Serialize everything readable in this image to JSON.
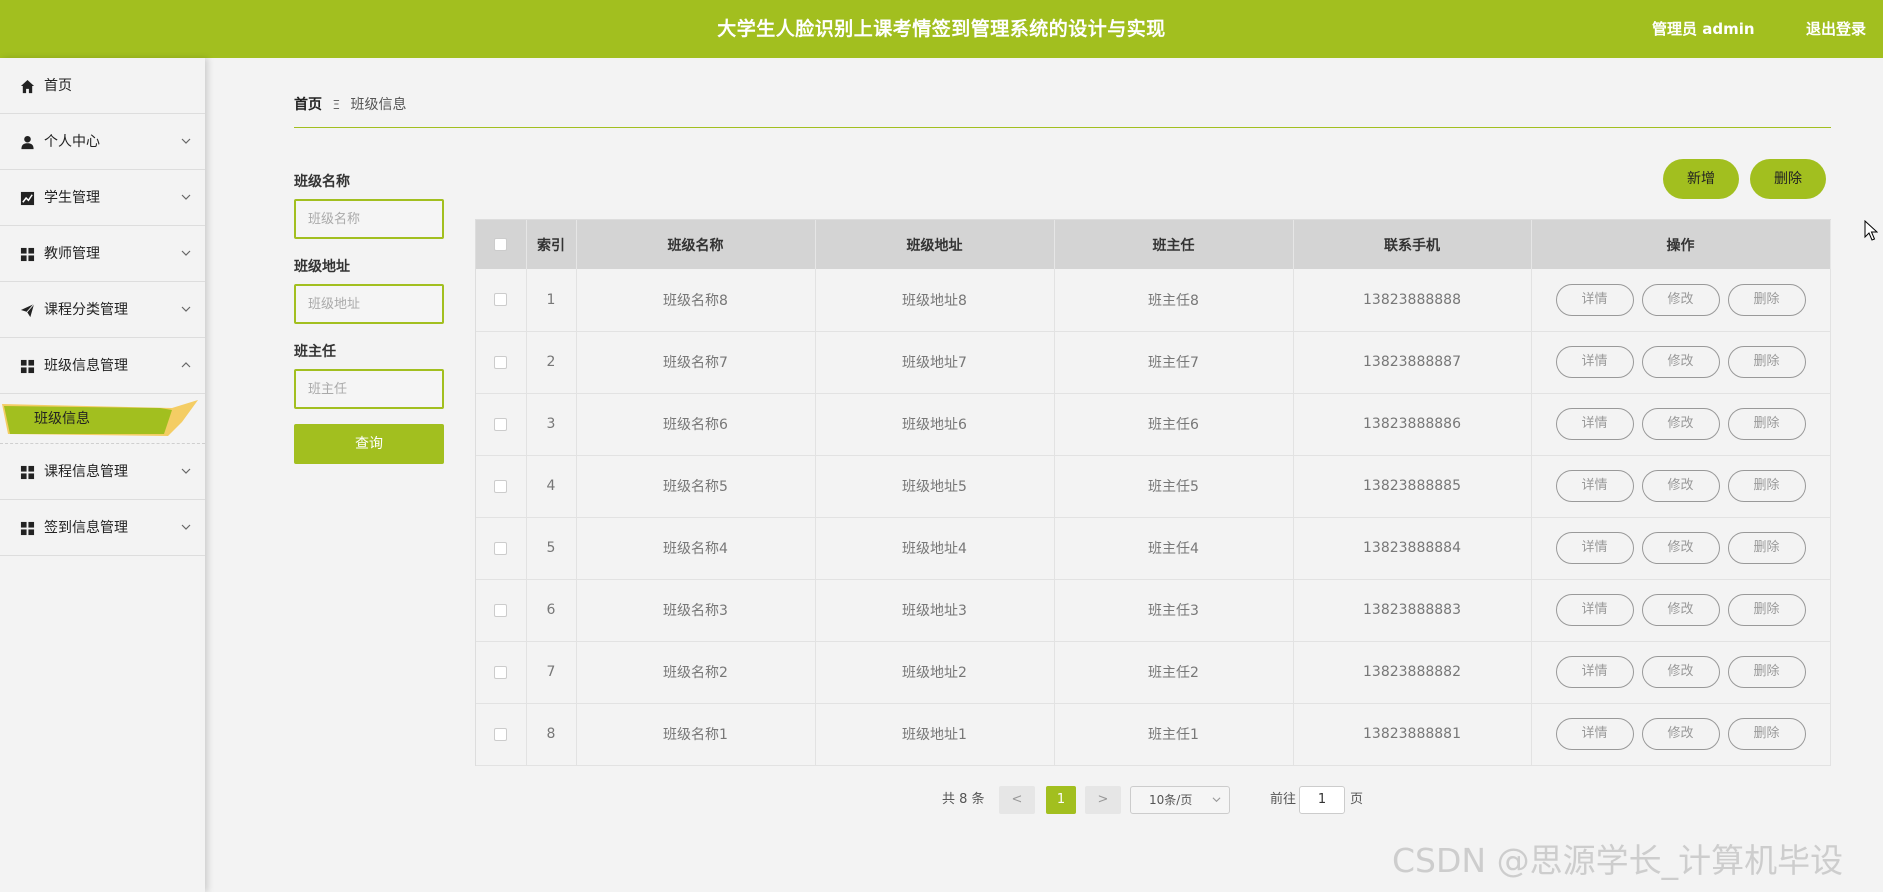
{
  "app": {
    "title": "大学生人脸识别上课考情签到管理系统的设计与实现",
    "admin_label": "管理员 admin",
    "logout_label": "退出登录",
    "accent": "#a2bf1f"
  },
  "sidebar": {
    "items": [
      {
        "label": "首页",
        "icon": "home-icon"
      },
      {
        "label": "个人中心",
        "icon": "user-icon"
      },
      {
        "label": "学生管理",
        "icon": "chart-icon"
      },
      {
        "label": "教师管理",
        "icon": "grid-icon"
      },
      {
        "label": "课程分类管理",
        "icon": "send-icon"
      },
      {
        "label": "班级信息管理",
        "icon": "grid-icon"
      },
      {
        "label": "课程信息管理",
        "icon": "grid-icon"
      },
      {
        "label": "签到信息管理",
        "icon": "grid-icon"
      }
    ],
    "active_sub": "班级信息"
  },
  "breadcrumb": {
    "home": "首页",
    "separator": "Ξ",
    "current": "班级信息"
  },
  "search": {
    "class_name_label": "班级名称",
    "class_name_placeholder": "班级名称",
    "class_address_label": "班级地址",
    "class_address_placeholder": "班级地址",
    "head_teacher_label": "班主任",
    "head_teacher_placeholder": "班主任",
    "query_label": "查询"
  },
  "toolbar": {
    "add_label": "新增",
    "delete_label": "删除"
  },
  "table": {
    "columns": [
      "索引",
      "班级名称",
      "班级地址",
      "班主任",
      "联系手机",
      "操作"
    ],
    "rows": [
      {
        "index": "1",
        "name": "班级名称8",
        "address": "班级地址8",
        "teacher": "班主任8",
        "phone": "13823888888"
      },
      {
        "index": "2",
        "name": "班级名称7",
        "address": "班级地址7",
        "teacher": "班主任7",
        "phone": "13823888887"
      },
      {
        "index": "3",
        "name": "班级名称6",
        "address": "班级地址6",
        "teacher": "班主任6",
        "phone": "13823888886"
      },
      {
        "index": "4",
        "name": "班级名称5",
        "address": "班级地址5",
        "teacher": "班主任5",
        "phone": "13823888885"
      },
      {
        "index": "5",
        "name": "班级名称4",
        "address": "班级地址4",
        "teacher": "班主任4",
        "phone": "13823888884"
      },
      {
        "index": "6",
        "name": "班级名称3",
        "address": "班级地址3",
        "teacher": "班主任3",
        "phone": "13823888883"
      },
      {
        "index": "7",
        "name": "班级名称2",
        "address": "班级地址2",
        "teacher": "班主任2",
        "phone": "13823888882"
      },
      {
        "index": "8",
        "name": "班级名称1",
        "address": "班级地址1",
        "teacher": "班主任1",
        "phone": "13823888881"
      }
    ],
    "actions": {
      "detail": "详情",
      "edit": "修改",
      "delete": "删除"
    }
  },
  "pagination": {
    "total_text": "共 8 条",
    "prev": "<",
    "current_page": "1",
    "next": ">",
    "page_size": "10条/页",
    "goto_label": "前往",
    "goto_value": "1",
    "page_suffix": "页"
  },
  "watermark": "CSDN @思源学长_计算机毕设"
}
